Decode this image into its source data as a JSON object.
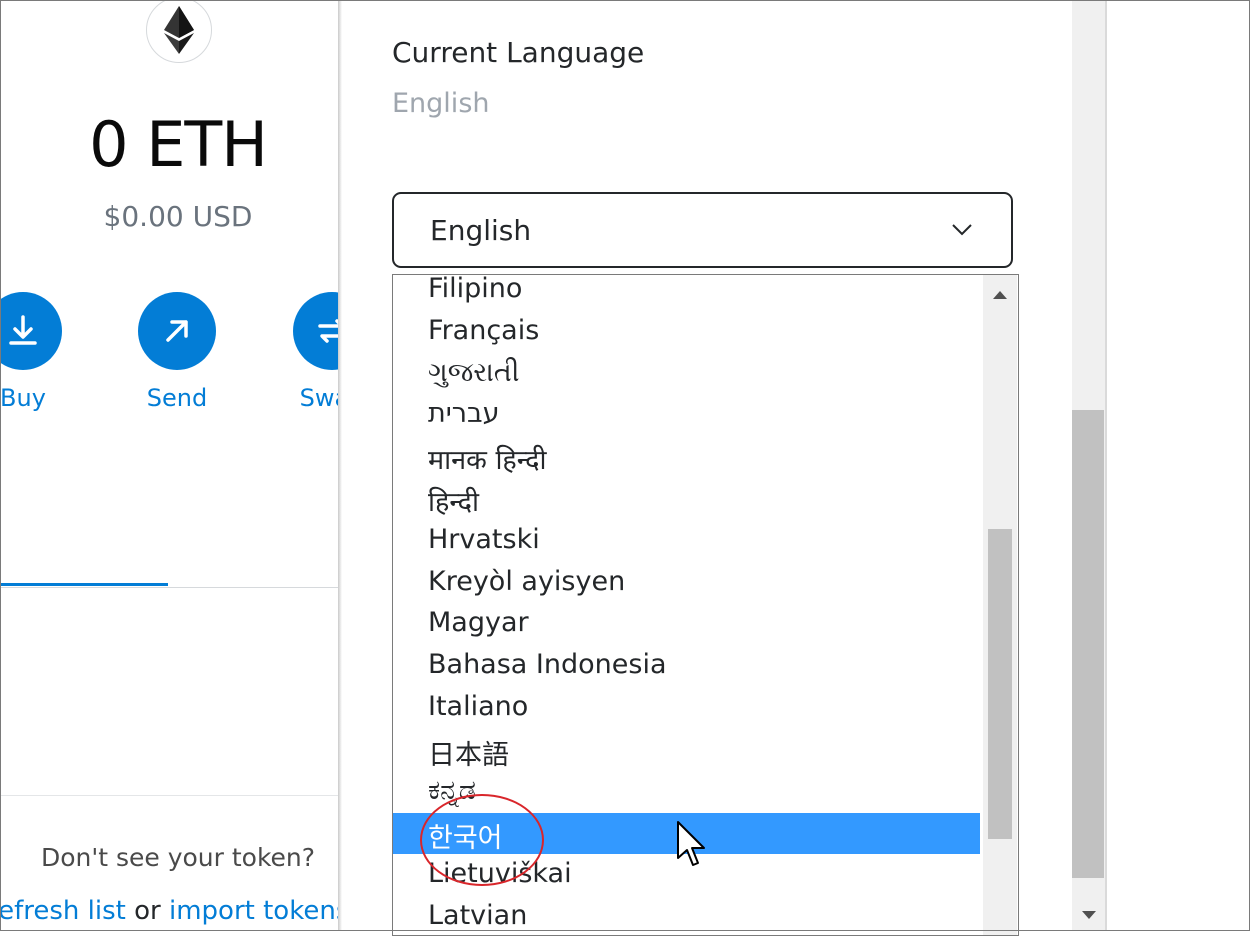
{
  "wallet": {
    "balance": "0 ETH",
    "fiat": "$0.00 USD",
    "actions": [
      {
        "label": "Buy",
        "icon": "download-icon"
      },
      {
        "label": "Send",
        "icon": "arrow-up-right-icon"
      },
      {
        "label": "Swap",
        "icon": "swap-icon"
      }
    ],
    "dont_see_text": "Don't see your token?",
    "refresh_label": "refresh list",
    "or_text": "or",
    "import_label": "import tokens"
  },
  "settings": {
    "current_language_label": "Current Language",
    "current_language_value": "English",
    "select_value": "English"
  },
  "dropdown": {
    "items": [
      "Filipino",
      "Français",
      "ગુજરાતી",
      "עברית",
      "मानक हिन्दी",
      "हिन्दी",
      "Hrvatski",
      "Kreyòl ayisyen",
      "Magyar",
      "Bahasa Indonesia",
      "Italiano",
      "日本語",
      "ಕನ್ನಡ",
      "한국어",
      "Lietuviškai",
      "Latvian"
    ],
    "selected_index": 13
  },
  "colors": {
    "accent": "#037dd6",
    "selection": "#3399ff",
    "annotation": "#d9262b"
  }
}
